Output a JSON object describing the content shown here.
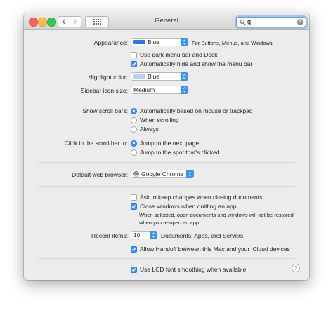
{
  "window": {
    "title": "General"
  },
  "search": {
    "value": "g"
  },
  "appearance": {
    "label": "Appearance:",
    "value": "Blue",
    "swatch_color": "#2a7ae4",
    "note": "For Buttons, Menus, and Windows",
    "dark_menu": {
      "label": "Use dark menu bar and Dock",
      "checked": false
    },
    "auto_hide": {
      "label": "Automatically hide and show the menu bar",
      "checked": true
    }
  },
  "highlight": {
    "label": "Highlight color:",
    "value": "Blue",
    "swatch_color": "#b7d2f1"
  },
  "sidebar_icon": {
    "label": "Sidebar icon size:",
    "value": "Medium"
  },
  "scroll_bars": {
    "label": "Show scroll bars:",
    "options": [
      "Automatically based on mouse or trackpad",
      "When scrolling",
      "Always"
    ],
    "selected": 0
  },
  "click_scroll": {
    "label": "Click in the scroll bar to:",
    "options": [
      "Jump to the next page",
      "Jump to the spot that's clicked"
    ],
    "selected": 0
  },
  "browser": {
    "label": "Default web browser:",
    "value": "Google Chrome"
  },
  "documents": {
    "ask_keep": {
      "label": "Ask to keep changes when closing documents",
      "checked": false
    },
    "close_windows": {
      "label": "Close windows when quitting an app",
      "checked": true
    },
    "note_line1": "When selected, open documents and windows will not be restored",
    "note_line2": "when you re-open an app."
  },
  "recent": {
    "label": "Recent items:",
    "value": "10",
    "suffix": "Documents, Apps, and Servers"
  },
  "handoff": {
    "label": "Allow Handoff between this Mac and your iCloud devices",
    "checked": true
  },
  "lcd": {
    "label": "Use LCD font smoothing when available",
    "checked": true
  },
  "help": {
    "label": "?"
  },
  "colors": {
    "accent": "#3c8ff5",
    "close": "#fc605b",
    "minimize": "#fdbc40",
    "zoom": "#34c84a"
  }
}
